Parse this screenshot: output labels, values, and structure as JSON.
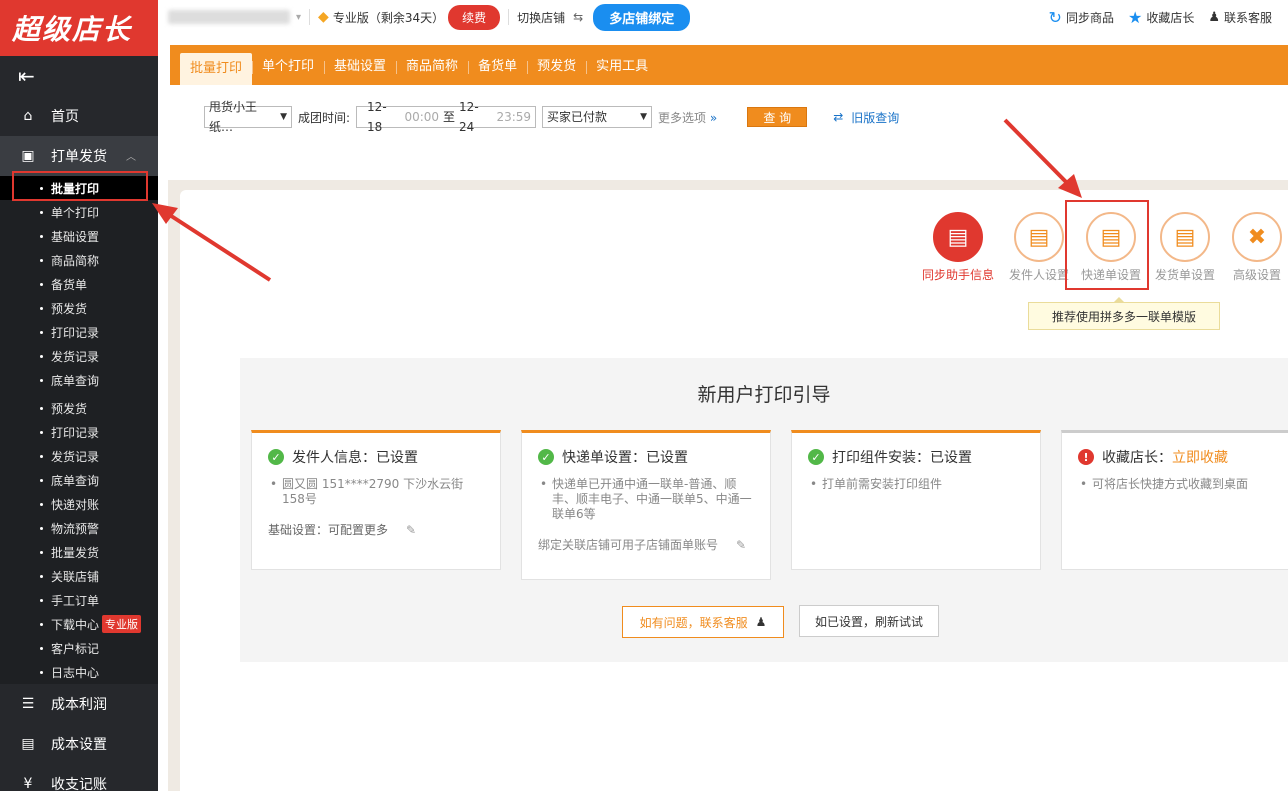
{
  "logo": "超级店长",
  "sidebar": {
    "collapse_icon": "menu-collapse-icon",
    "items": [
      {
        "label": "首页",
        "icon": "home-icon"
      },
      {
        "label": "打单发货",
        "icon": "printer-icon"
      }
    ],
    "sub_items": [
      "批量打印",
      "单个打印",
      "基础设置",
      "商品简称",
      "备货单",
      "预发货",
      "打印记录",
      "发货记录",
      "底单查询",
      "预发货",
      "打印记录",
      "发货记录",
      "底单查询",
      "快递对账",
      "物流预警",
      "批量发货",
      "关联店铺",
      "手工订单",
      "下载中心",
      "客户标记",
      "日志中心"
    ],
    "pro_badge": "专业版",
    "bottom_items": [
      {
        "label": "成本利润",
        "icon": "database-icon"
      },
      {
        "label": "成本设置",
        "icon": "settings-doc-icon"
      },
      {
        "label": "收支记账",
        "icon": "yuan-icon"
      }
    ]
  },
  "topbar": {
    "version": "专业版（剩余34天）",
    "renew": "续费",
    "switch_shop": "切换店铺",
    "multi_shop": "多店铺绑定",
    "sync_goods": "同步商品",
    "bookmark": "收藏店长",
    "contact": "联系客服"
  },
  "tabs": [
    "批量打印",
    "单个打印",
    "基础设置",
    "商品简称",
    "备货单",
    "预发货",
    "实用工具"
  ],
  "filters": {
    "shop": "甩货小王纸…",
    "time_label": "成团时间:",
    "start_date": "12-18",
    "start_time": "00:00",
    "to": "至",
    "end_date": "12-24",
    "end_time": "23:59",
    "status": "买家已付款",
    "more": "更多选项",
    "query": "查 询",
    "old_query": "旧版查询"
  },
  "tools": [
    {
      "label": "同步助手信息",
      "icon": "sync-helper-icon"
    },
    {
      "label": "发件人设置",
      "icon": "sender-icon"
    },
    {
      "label": "快递单设置",
      "icon": "express-sheet-icon"
    },
    {
      "label": "发货单设置",
      "icon": "delivery-sheet-icon"
    },
    {
      "label": "高级设置",
      "icon": "tools-icon"
    }
  ],
  "tooltip": "推荐使用拼多多一联单模版",
  "guide": {
    "title": "新用户打印引导",
    "cards": [
      {
        "title": "发件人信息：已设置",
        "items": [
          "圆又圆 151****2790 下沙水云街158号"
        ],
        "footer_label": "基础设置：",
        "footer_link": "可配置更多"
      },
      {
        "title": "快递单设置：已设置",
        "items": [
          "快递单已开通中通一联单-普通、顺丰、顺丰电子、中通一联单5、中通一联单6等"
        ],
        "footer_label": "绑定关联店铺可用子店铺面单账号",
        "footer_link": ""
      },
      {
        "title": "打印组件安装：已设置",
        "items": [
          "打单前需安装打印组件"
        ]
      },
      {
        "title": "收藏店长：",
        "title_link": "立即收藏",
        "items": [
          "可将店长快捷方式收藏到桌面"
        ]
      }
    ],
    "help_button": "如有问题，联系客服",
    "retry_button": "如已设置，刷新试试"
  },
  "colors": {
    "brand_red": "#e0382f",
    "orange": "#f08c1e",
    "blue": "#1a8ef0",
    "sidebar": "#26282c"
  }
}
